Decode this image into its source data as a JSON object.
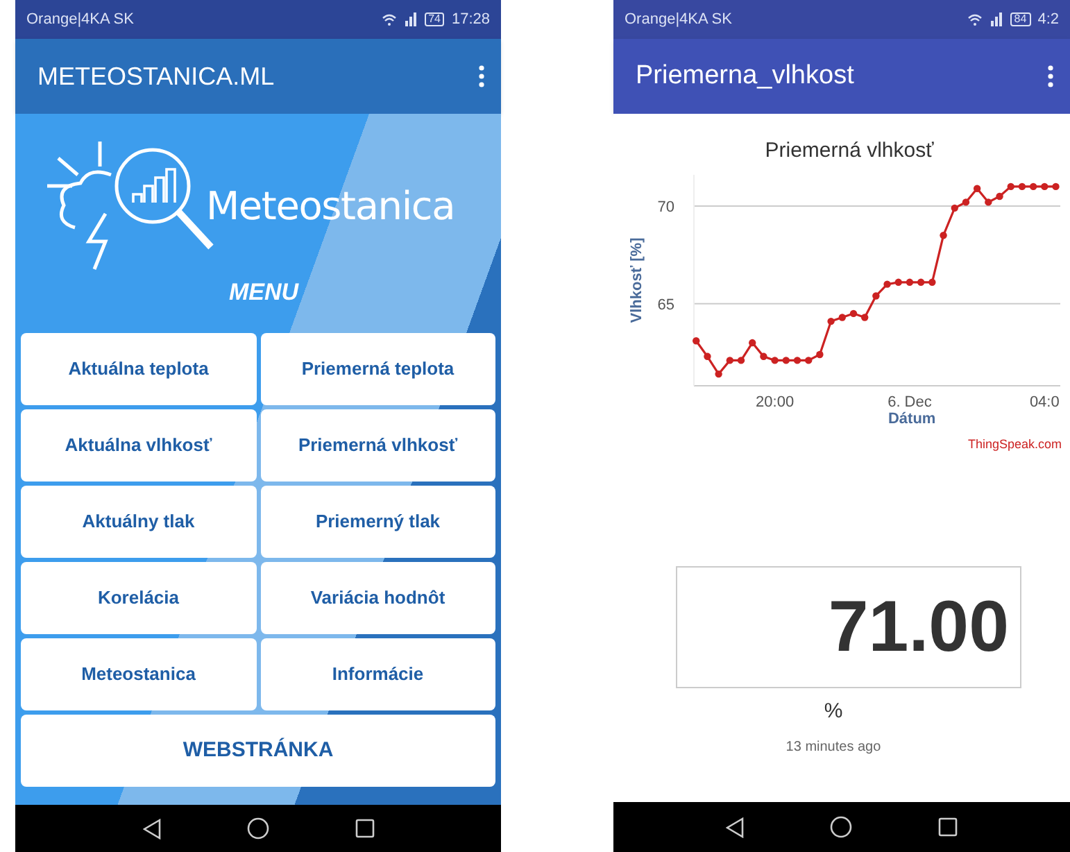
{
  "left_phone": {
    "status_bar": {
      "carrier": "Orange|4KA SK",
      "battery": "74",
      "time": "17:28"
    },
    "app_bar": {
      "title": "METEOSTANICA.ML"
    },
    "banner": {
      "logo_text": "Meteostanica",
      "menu_label": "MENU"
    },
    "menu_buttons": [
      {
        "label": "Aktuálna teplota",
        "kind": "half"
      },
      {
        "label": "Priemerná teplota",
        "kind": "half"
      },
      {
        "label": "Aktuálna vlhkosť",
        "kind": "half"
      },
      {
        "label": "Priemerná vlhkosť",
        "kind": "half"
      },
      {
        "label": "Aktuálny tlak",
        "kind": "half"
      },
      {
        "label": "Priemerný tlak",
        "kind": "half"
      },
      {
        "label": "Korelácia",
        "kind": "half"
      },
      {
        "label": "Variácia hodnôt",
        "kind": "half"
      },
      {
        "label": "Meteostanica",
        "kind": "half"
      },
      {
        "label": "Informácie",
        "kind": "half"
      },
      {
        "label": "WEBSTRÁNKA",
        "kind": "full"
      }
    ]
  },
  "right_phone": {
    "status_bar": {
      "carrier": "Orange|4KA SK",
      "battery": "84",
      "time": "4:2"
    },
    "app_bar": {
      "title": "Priemerna_vlhkost"
    },
    "chart": {
      "chart_data": {
        "type": "line",
        "title": "Priemerná vlhkosť",
        "xlabel": "Dátum",
        "ylabel": "Vlhkosť [%]",
        "categories": [
          null,
          null,
          null,
          null,
          null,
          null,
          null,
          "20:00",
          null,
          null,
          null,
          null,
          null,
          null,
          null,
          null,
          null,
          null,
          null,
          "6. Dec",
          null,
          null,
          null,
          null,
          null,
          null,
          null,
          null,
          null,
          null,
          null,
          "04:0",
          null
        ],
        "ylim": [
          60.8,
          71.6
        ],
        "series": [
          {
            "color": "#cc2222",
            "marker": "circle",
            "values": [
              63.1,
              62.3,
              61.4,
              62.1,
              62.1,
              63.0,
              62.3,
              62.1,
              62.1,
              62.1,
              62.1,
              62.4,
              64.1,
              64.3,
              64.5,
              64.3,
              65.4,
              66.0,
              66.1,
              66.1,
              66.1,
              66.1,
              68.5,
              69.9,
              70.2,
              70.9,
              70.2,
              70.5,
              71.0,
              71.0,
              71.0,
              71.0,
              71.0
            ]
          }
        ],
        "yticks": [
          65,
          70
        ]
      },
      "credit": "ThingSpeak.com"
    },
    "value_display": {
      "value": "71.00",
      "unit": "%",
      "updated": "13 minutes ago"
    }
  }
}
